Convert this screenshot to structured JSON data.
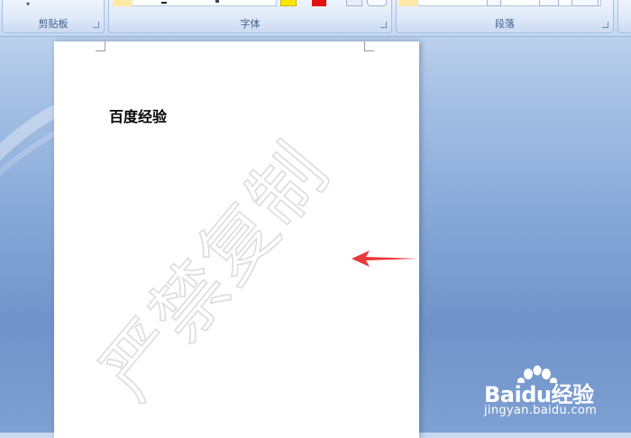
{
  "ribbon": {
    "groups": [
      {
        "label": "剪贴板"
      },
      {
        "label": "字体"
      },
      {
        "label": "段落"
      }
    ]
  },
  "document": {
    "heading": "百度经验",
    "watermark_text": "严禁复制"
  },
  "branding": {
    "logo_text": "Baidu经验",
    "url": "jingyan.baidu.com"
  },
  "colors": {
    "annotation_arrow": "#e8393a",
    "highlight_yellow": "#ffe600",
    "font_red": "#e41010"
  }
}
